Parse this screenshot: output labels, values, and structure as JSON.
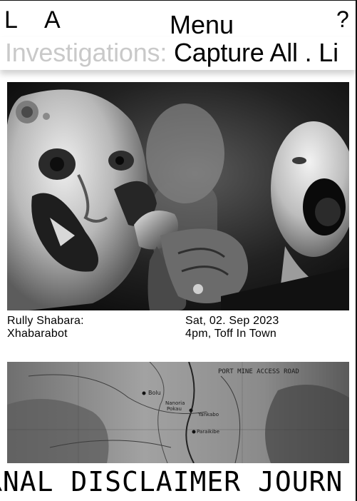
{
  "header": {
    "brand_left": "L",
    "brand_right": "A",
    "menu_label": "Menu",
    "help_label": "?"
  },
  "ticker": {
    "prefix": "Investigations:",
    "text": "Capture All . Li"
  },
  "event": {
    "title_line1": "Rully Shabara:",
    "title_line2": "Xhabarabot",
    "date": "Sat, 02. Sep 2023",
    "time_venue": "4pm, Toff In Town"
  },
  "map": {
    "labels": [
      "PORT MINE ACCESS ROAD",
      "Bolu",
      "Nanoria",
      "Pokau",
      "Yankabo",
      "Paraikibe"
    ]
  },
  "marquee": {
    "text": "RNAL DISCLAIMER JOURN"
  },
  "colors": {
    "prefix_gray": "#c9c9c9",
    "text_black": "#000000",
    "background": "#ffffff"
  }
}
